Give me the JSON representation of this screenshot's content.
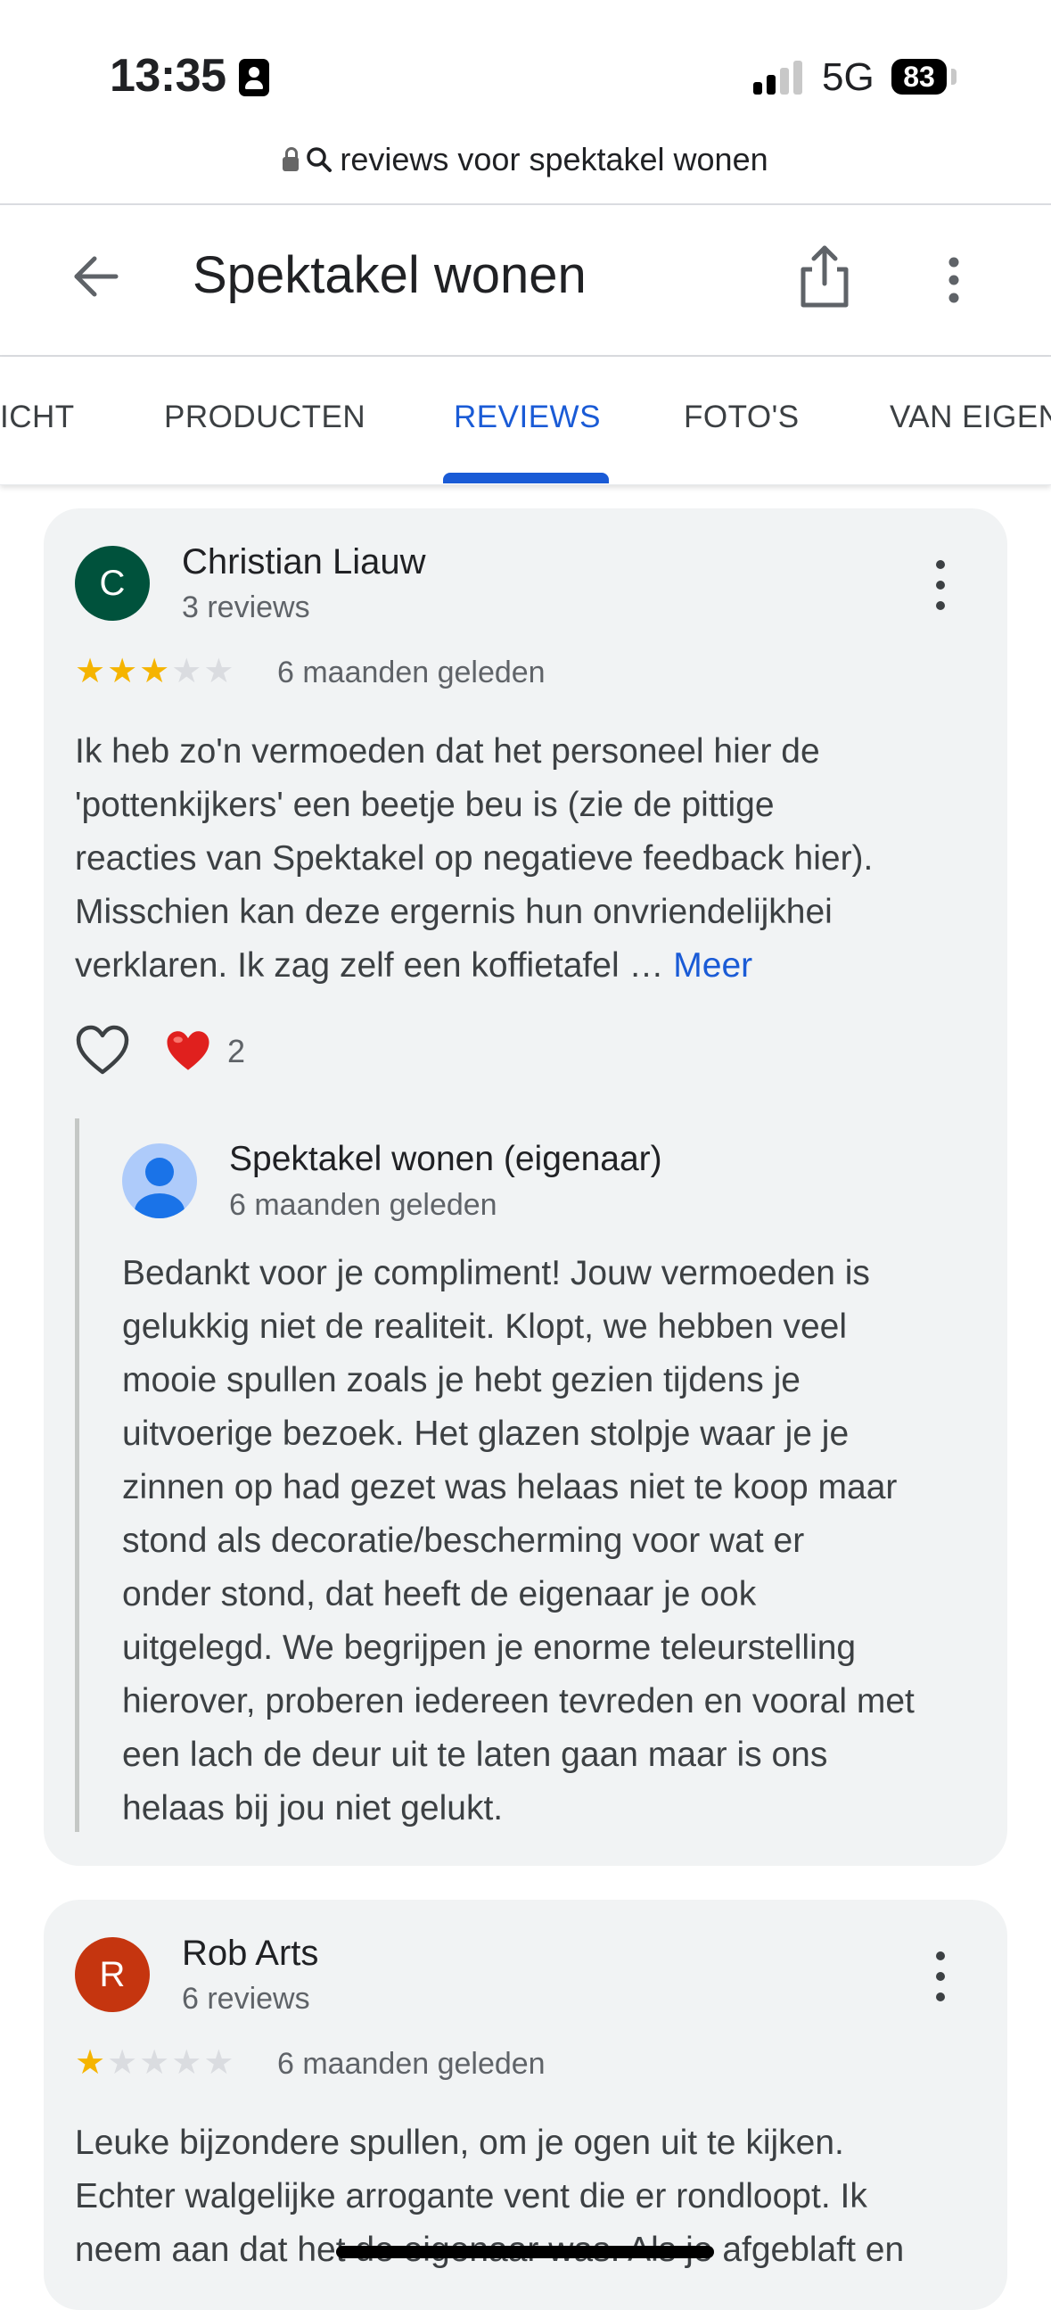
{
  "status_bar": {
    "time": "13:35",
    "network": "5G",
    "battery": "83"
  },
  "browser": {
    "url_text": "reviews voor spektakel wonen"
  },
  "header": {
    "title": "Spektakel wonen"
  },
  "tabs": [
    {
      "label": "ICHT"
    },
    {
      "label": "PRODUCTEN"
    },
    {
      "label": "REVIEWS",
      "active": true
    },
    {
      "label": "FOTO'S"
    },
    {
      "label": "VAN EIGEN"
    }
  ],
  "reviews": [
    {
      "initial": "C",
      "avatar_color": "#00523c",
      "name": "Christian Liauw",
      "review_count": "3 reviews",
      "rating": 3,
      "date": "6 maanden geleden",
      "text_lines": [
        "Ik heb zo'n vermoeden dat het personeel hier de",
        "'pottenkijkers' een beetje beu is (zie de pittige",
        "reacties van Spektakel op negatieve feedback hier).",
        "Misschien kan deze ergernis hun onvriendelijkhei",
        "verklaren. Ik zag zelf een koffietafel …"
      ],
      "more_label": "Meer",
      "likes": "2",
      "owner_reply": {
        "name": "Spektakel wonen (eigenaar)",
        "date": "6 maanden geleden",
        "text_lines": [
          "Bedankt voor je compliment! Jouw vermoeden is",
          "gelukkig niet de realiteit. Klopt, we hebben veel",
          "mooie spullen zoals je hebt gezien tijdens je",
          "uitvoerige bezoek. Het glazen stolpje waar je je",
          "zinnen op had gezet was helaas niet te koop maar",
          "stond als decoratie/bescherming voor wat er",
          "onder stond, dat heeft de eigenaar je ook",
          "uitgelegd. We begrijpen je enorme teleurstelling",
          "hierover, proberen iedereen tevreden en vooral met",
          "een lach de deur uit te laten gaan maar is ons",
          "helaas bij jou niet gelukt."
        ]
      }
    },
    {
      "initial": "R",
      "avatar_color": "#c5350f",
      "name": "Rob Arts",
      "review_count": "6 reviews",
      "rating": 1,
      "date": "6 maanden geleden",
      "text_lines": [
        "Leuke bijzondere spullen, om je ogen uit te kijken.",
        "Echter walgelijke arrogante vent die er rondloopt. Ik",
        "neem aan dat het de eigenaar was. Als je afgeblaft en"
      ]
    }
  ],
  "colors": {
    "accent": "#1a5bd6",
    "star": "#f5b400",
    "card_bg": "#f1f3f4"
  }
}
